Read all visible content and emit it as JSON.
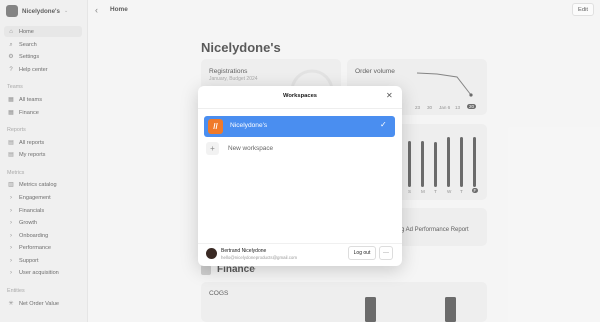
{
  "sidebar": {
    "workspace_name": "Nicelydone's",
    "nav": [
      {
        "label": "Home",
        "icon": "home-icon",
        "glyph": "⌂"
      },
      {
        "label": "Search",
        "icon": "search-icon",
        "glyph": "⌕"
      },
      {
        "label": "Settings",
        "icon": "gear-icon",
        "glyph": "⚙"
      },
      {
        "label": "Help center",
        "icon": "help-icon",
        "glyph": "?"
      }
    ],
    "teams_label": "Teams",
    "teams": [
      {
        "label": "All teams",
        "icon": "teams-icon",
        "glyph": "▦"
      },
      {
        "label": "Finance",
        "icon": "finance-icon",
        "glyph": "▦"
      }
    ],
    "reports_label": "Reports",
    "reports": [
      {
        "label": "All reports",
        "icon": "reports-icon",
        "glyph": "▤"
      },
      {
        "label": "My reports",
        "icon": "my-reports-icon",
        "glyph": "▤"
      }
    ],
    "metrics_label": "Metrics",
    "metrics": [
      {
        "label": "Metrics catalog",
        "icon": "catalog-icon",
        "glyph": "▥"
      },
      {
        "label": "Engagement",
        "glyph": "›"
      },
      {
        "label": "Financials",
        "glyph": "›"
      },
      {
        "label": "Growth",
        "glyph": "›"
      },
      {
        "label": "Onboarding",
        "glyph": "›"
      },
      {
        "label": "Performance",
        "glyph": "›"
      },
      {
        "label": "Support",
        "glyph": "›"
      },
      {
        "label": "User acquisition",
        "glyph": "›"
      }
    ],
    "entities_label": "Entities",
    "entities": [
      {
        "label": "Net Order Value",
        "icon": "entity-icon",
        "glyph": "✳"
      }
    ]
  },
  "header": {
    "breadcrumb": "Home",
    "edit_label": "Edit"
  },
  "main": {
    "title": "Nicelydone's",
    "registrations": {
      "title": "Registrations",
      "subtitle": "January, Budget 2024"
    },
    "order_volume": {
      "title": "Order volume",
      "date_labels": [
        "23",
        "30",
        "Jan 6",
        "13",
        "20"
      ]
    },
    "weekday_labels": [
      "S",
      "M",
      "T",
      "W",
      "T",
      "F"
    ],
    "report_card_text": "g Ad Performance Report",
    "finance_title": "Finance",
    "cogs_title": "COGS"
  },
  "modal": {
    "title": "Workspaces",
    "workspaces": [
      {
        "name": "Nicelydone's",
        "selected": true
      }
    ],
    "new_workspace_label": "New workspace",
    "user_name": "Bertrand Nicelydone",
    "user_email": "hello@nicelydoneproducts@gmail.com",
    "logout_label": "Log out",
    "more_glyph": "···"
  },
  "colors": {
    "accent": "#4a8ef0",
    "workspace_logo": "#f07a2a"
  }
}
